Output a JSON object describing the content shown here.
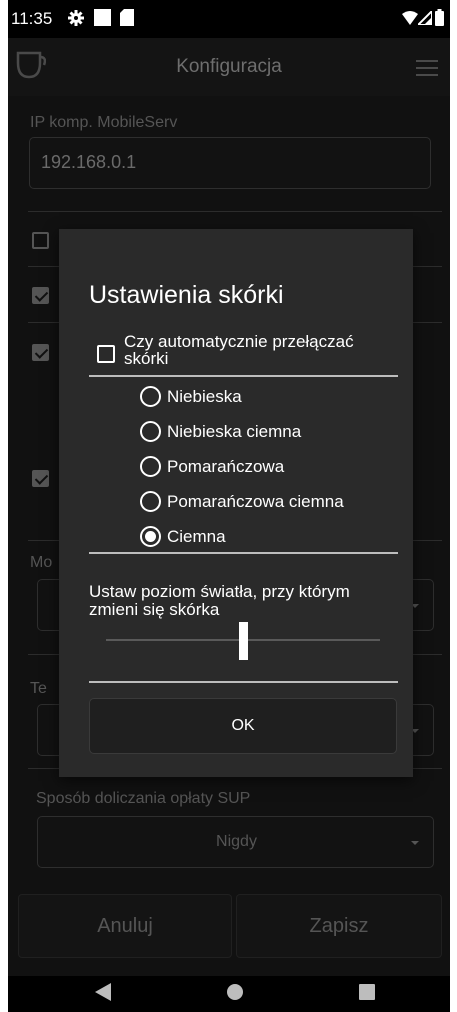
{
  "status_bar": {
    "time": "11:35",
    "icons": [
      "gear-icon",
      "square-icon",
      "sd-card-icon",
      "wifi-icon",
      "signal-icon",
      "battery-icon"
    ]
  },
  "app_bar": {
    "title": "Konfiguracja",
    "logo_icon": "cup-logo-icon",
    "menu_icon": "hamburger-menu-icon"
  },
  "background": {
    "ip_label": "IP komp. MobileServ",
    "ip_value": "192.168.0.1",
    "partial_label_1": "Mo",
    "partial_label_2": "Te",
    "sup_label": "Sposób doliczania opłaty SUP",
    "sup_value": "Nigdy",
    "cancel_label": "Anuluj",
    "save_label": "Zapisz"
  },
  "dialog": {
    "title": "Ustawienia skórki",
    "auto_switch_label": "Czy automatycznie przełączać skórki",
    "auto_switch_checked": false,
    "skins": [
      {
        "label": "Niebieska",
        "selected": false
      },
      {
        "label": "Niebieska ciemna",
        "selected": false
      },
      {
        "label": "Pomarańczowa",
        "selected": false
      },
      {
        "label": "Pomarańczowa ciemna",
        "selected": false
      },
      {
        "label": "Ciemna",
        "selected": true
      }
    ],
    "light_level_label": "Ustaw poziom światła, przy którym zmieni się skórka",
    "light_level_fraction": 0.49,
    "ok_label": "OK"
  },
  "nav_bar": {
    "icons": [
      "back-icon",
      "home-icon",
      "recents-icon"
    ]
  },
  "colors": {
    "dialog_bg": "#2a2a2a",
    "app_bg": "#111111",
    "text_dim": "#555555",
    "text_primary": "#ffffff"
  }
}
